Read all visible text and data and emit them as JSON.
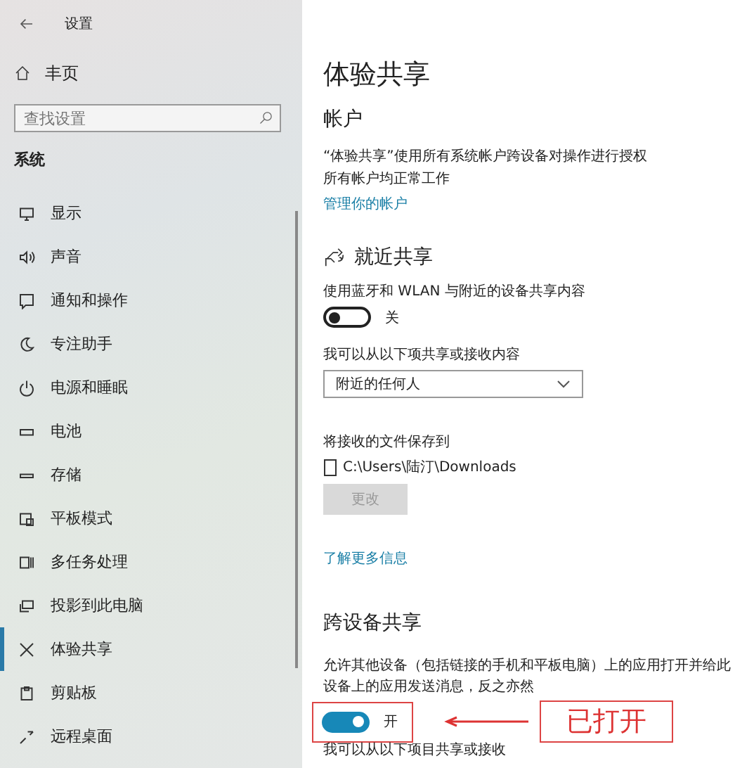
{
  "sidebar": {
    "title": "设置",
    "home": "丰页",
    "search": {
      "placeholder": "查找设置"
    },
    "section": "系统",
    "items": [
      {
        "label": "显示",
        "selected": false
      },
      {
        "label": "声音",
        "selected": false
      },
      {
        "label": "通知和操作",
        "selected": false
      },
      {
        "label": "专注助手",
        "selected": false
      },
      {
        "label": "电源和睡眠",
        "selected": false
      },
      {
        "label": "电池",
        "selected": false
      },
      {
        "label": "存储",
        "selected": false
      },
      {
        "label": "平板模式",
        "selected": false
      },
      {
        "label": "多任务处理",
        "selected": false
      },
      {
        "label": "投影到此电脑",
        "selected": false
      },
      {
        "label": "体验共享",
        "selected": true
      },
      {
        "label": "剪贴板",
        "selected": false
      },
      {
        "label": "远程桌面",
        "selected": false
      }
    ]
  },
  "content": {
    "title": "体验共享",
    "account": {
      "heading": "帐户",
      "lines": [
        "“体验共享”使用所有系统帐户跨设备对操作进行授权",
        "所有帐户均正常工作"
      ],
      "link": "管理你的帐户"
    },
    "nearby": {
      "heading": "就近共享",
      "description": "使用蓝牙和 WLAN 与附近的设备共享内容",
      "toggle": {
        "on": false,
        "label": "关"
      },
      "share_label": "我可以从以下项共享或接收内容",
      "dropdown": {
        "value": "附近的任何人"
      },
      "save_label": "将接收的文件保存到",
      "path": "C:\\Users\\陆汀\\Downloads",
      "change_button": {
        "label": "更改",
        "disabled": true
      },
      "link": "了解更多信息"
    },
    "cross_device": {
      "heading": "跨设备共享",
      "description": "允许其他设备（包括链接的手机和平板电脑）上的应用打开并给此设备上的应用发送消息，反之亦然",
      "toggle": {
        "on": true,
        "label": "开"
      },
      "share_label": "我可以从以下项目共享或接收"
    },
    "annotation": {
      "callout": "已打开"
    }
  }
}
